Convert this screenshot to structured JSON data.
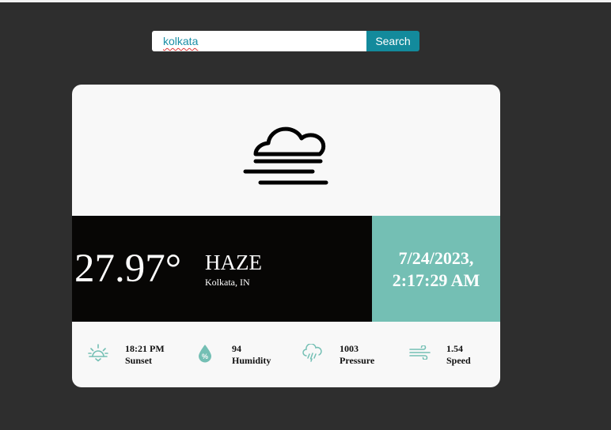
{
  "search": {
    "value": "kolkata",
    "button_label": "Search"
  },
  "weather": {
    "icon": "haze-icon",
    "temperature": "27.97°",
    "condition": "HAZE",
    "location": "Kolkata, IN",
    "date": "7/24/2023,",
    "time": "2:17:29 AM"
  },
  "stats": [
    {
      "value": "18:21 PM",
      "label": "Sunset",
      "icon": "sunset-icon"
    },
    {
      "value": "94",
      "label": "Humidity",
      "icon": "humidity-icon"
    },
    {
      "value": "1003",
      "label": "Pressure",
      "icon": "pressure-icon"
    },
    {
      "value": "1.54",
      "label": "Speed",
      "icon": "wind-icon"
    }
  ],
  "colors": {
    "page_background": "#2e2e2e",
    "accent": "#74bfb4",
    "search_button": "#138a9c",
    "temp_panel": "#070605"
  }
}
